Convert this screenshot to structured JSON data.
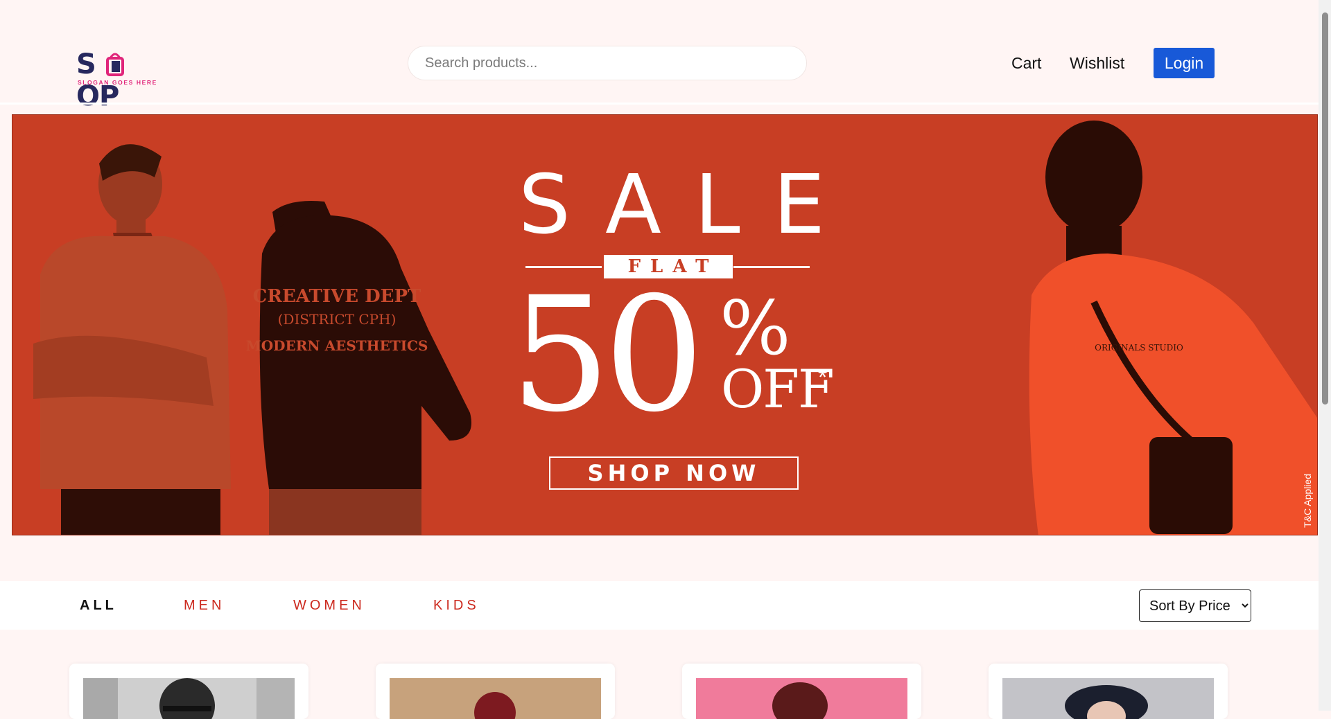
{
  "logo": {
    "text_left": "S",
    "text_right": "OP",
    "slogan": "SLOGAN GOES HERE"
  },
  "search": {
    "placeholder": "Search products..."
  },
  "nav": {
    "cart": "Cart",
    "wishlist": "Wishlist",
    "login": "Login"
  },
  "banner": {
    "sale": "SALE",
    "flat": "FLAT",
    "fifty": "50",
    "percent": "%",
    "off": "OFF",
    "asterisk": "*",
    "shop_now": "SHOP NOW",
    "tc": "T&C Applied",
    "hoodie_print": [
      "CREATIVE DEPT",
      "(DISTRICT CPH)",
      "MODERN AESTHETICS"
    ],
    "tee_print": "ORIGINALS STUDIO"
  },
  "categories": [
    {
      "label": "ALL",
      "active": true
    },
    {
      "label": "MEN",
      "active": false
    },
    {
      "label": "WOMEN",
      "active": false
    },
    {
      "label": "KIDS",
      "active": false
    }
  ],
  "sort": {
    "selected": "Sort By Price"
  },
  "colors": {
    "accent": "#1859d8",
    "banner": "#c83e24",
    "category": "#cc2a1f",
    "page_bg": "#fff5f4"
  }
}
